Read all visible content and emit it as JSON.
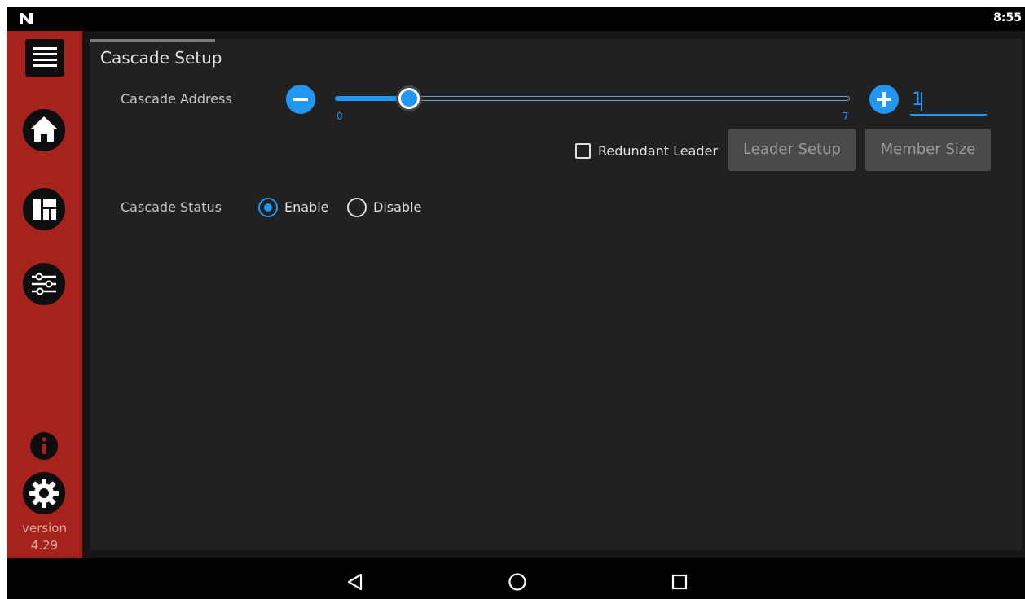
{
  "status_bar": {
    "time": "8:55",
    "logo_icon": "n-logo-icon"
  },
  "sidebar": {
    "items": [
      {
        "icon": "menu-icon"
      },
      {
        "icon": "home-icon"
      },
      {
        "icon": "dashboard-icon"
      },
      {
        "icon": "sliders-icon"
      },
      {
        "icon": "info-icon"
      },
      {
        "icon": "gear-icon"
      }
    ],
    "version_label": "version",
    "version_number": "4.29",
    "background_color": "#a6221c"
  },
  "page": {
    "title": "Cascade Setup"
  },
  "cascade_address": {
    "label": "Cascade Address",
    "slider_min": "0",
    "slider_max": "7",
    "value": "1",
    "accent_color": "#2196f3"
  },
  "redundant_leader": {
    "label": "Redundant Leader",
    "checked": false
  },
  "buttons": {
    "leader_setup": "Leader Setup",
    "member_size": "Member Size"
  },
  "cascade_status": {
    "label": "Cascade Status",
    "options": [
      {
        "label": "Enable",
        "selected": true
      },
      {
        "label": "Disable",
        "selected": false
      }
    ]
  },
  "nav_bar": {
    "items": [
      {
        "icon": "back-icon"
      },
      {
        "icon": "home-circle-icon"
      },
      {
        "icon": "recents-icon"
      }
    ]
  }
}
